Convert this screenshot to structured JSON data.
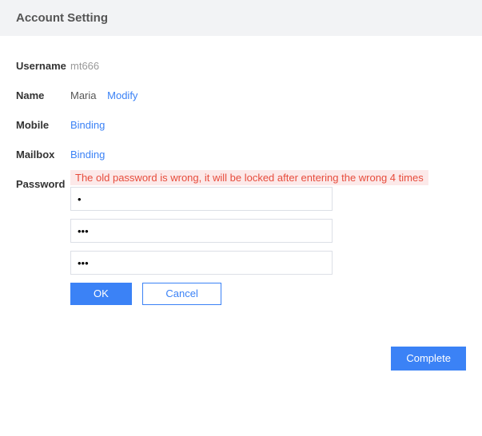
{
  "header": {
    "title": "Account Setting"
  },
  "fields": {
    "username": {
      "label": "Username",
      "value": "mt666"
    },
    "name": {
      "label": "Name",
      "value": "Maria",
      "modify_link": "Modify"
    },
    "mobile": {
      "label": "Mobile",
      "binding_link": "Binding"
    },
    "mailbox": {
      "label": "Mailbox",
      "binding_link": "Binding"
    },
    "password": {
      "label": "Password",
      "error": "The old password is wrong, it will be locked after entering the wrong 4 times",
      "old_value": "•",
      "new_value": "•••",
      "confirm_value": "•••",
      "ok_label": "OK",
      "cancel_label": "Cancel"
    }
  },
  "footer": {
    "complete_label": "Complete"
  }
}
